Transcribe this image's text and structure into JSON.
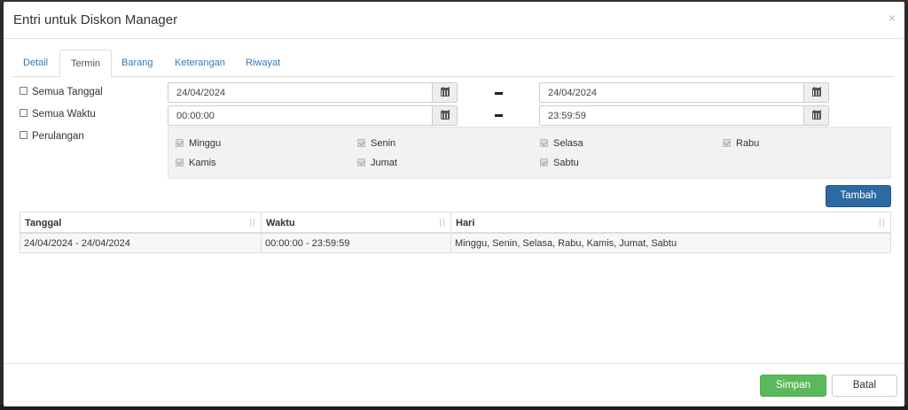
{
  "dialog": {
    "title": "Entri untuk Diskon Manager",
    "close_glyph": "×"
  },
  "tabs": [
    {
      "label": "Detail",
      "active": false
    },
    {
      "label": "Termin",
      "active": true
    },
    {
      "label": "Barang",
      "active": false
    },
    {
      "label": "Keterangan",
      "active": false
    },
    {
      "label": "Riwayat",
      "active": false
    }
  ],
  "options": {
    "all_dates": "Semua Tanggal",
    "all_times": "Semua Waktu",
    "repeat": "Perulangan"
  },
  "date_range": {
    "start": "24/04/2024",
    "end": "24/04/2024"
  },
  "time_range": {
    "start": "00:00:00",
    "end": "23:59:59"
  },
  "days": [
    {
      "label": "Minggu",
      "checked": true
    },
    {
      "label": "Senin",
      "checked": true
    },
    {
      "label": "Selasa",
      "checked": true
    },
    {
      "label": "Rabu",
      "checked": true
    },
    {
      "label": "Kamis",
      "checked": true
    },
    {
      "label": "Jumat",
      "checked": true
    },
    {
      "label": "Sabtu",
      "checked": true
    }
  ],
  "add_button": "Tambah",
  "table": {
    "columns": [
      "Tanggal",
      "Waktu",
      "Hari"
    ],
    "rows": [
      [
        "24/04/2024 - 24/04/2024",
        "00:00:00 - 23:59:59",
        "Minggu, Senin, Selasa, Rabu, Kamis, Jumat, Sabtu"
      ]
    ]
  },
  "footer": {
    "save": "Simpan",
    "cancel": "Batal"
  },
  "icons": {
    "calendar": "calendar-icon",
    "sort": "sort-icon",
    "close": "close-icon"
  },
  "colors": {
    "primary": "#2b6aa3",
    "success": "#5cb85c",
    "link": "#337ab7"
  }
}
